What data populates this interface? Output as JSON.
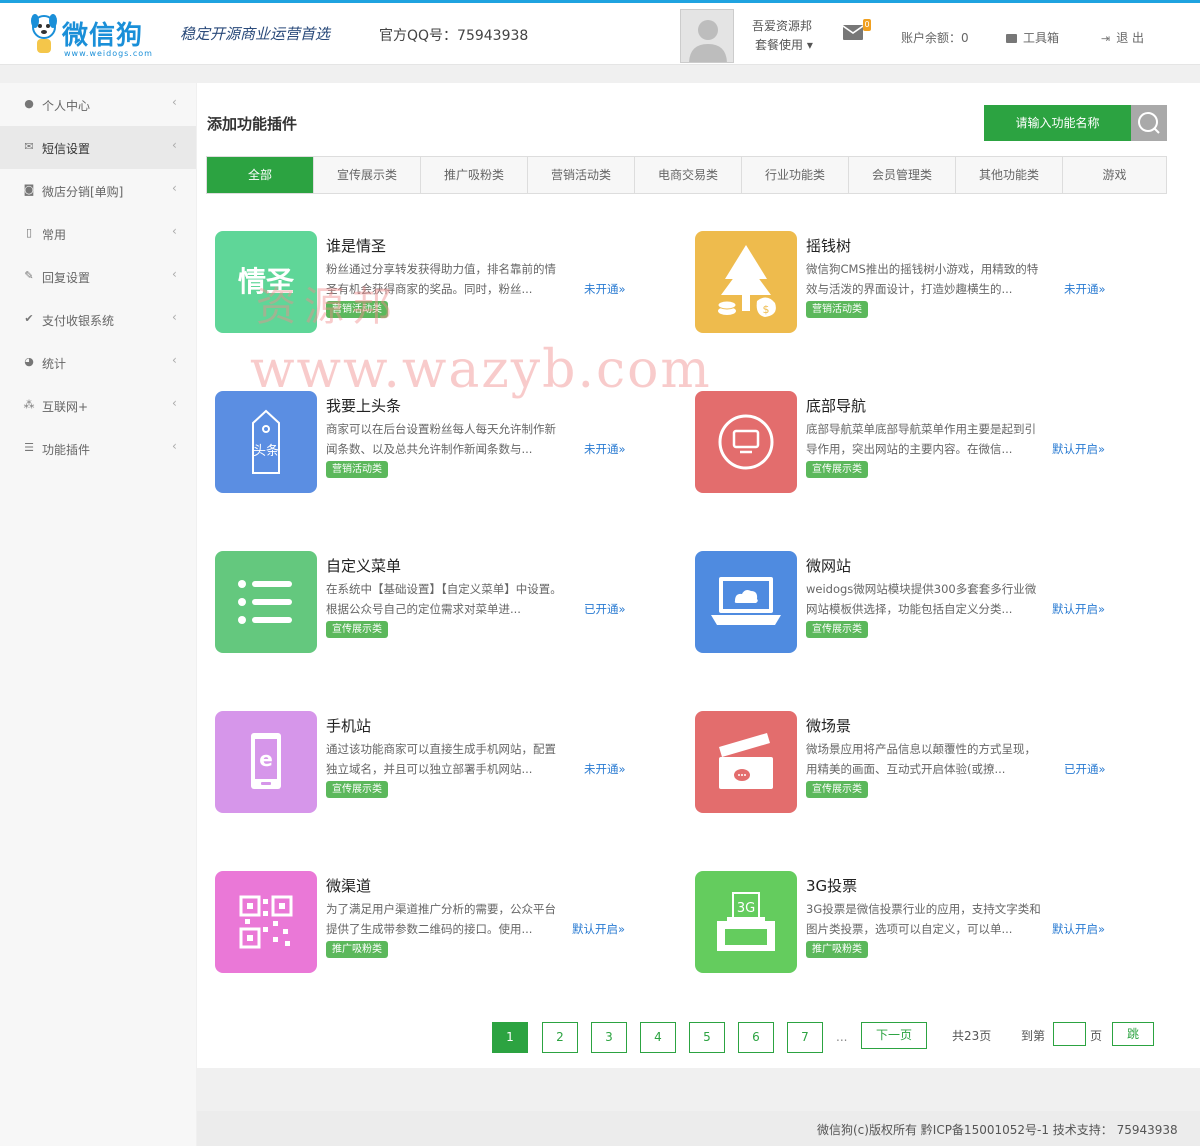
{
  "header": {
    "logo_text": "微信狗",
    "logo_sub": "www.weidogs.com",
    "slogan": "稳定开源商业运营首选",
    "qq": "官方QQ号：75943938",
    "username": "吾爱资源邦",
    "plan": "套餐使用 ▾",
    "mail_badge": "0",
    "balance": "账户余额：0",
    "toolbox": "工具箱",
    "logout": "退 出"
  },
  "sidebar": {
    "items": [
      {
        "label": "个人中心",
        "icon": "user-icon"
      },
      {
        "label": "短信设置",
        "icon": "envelope-icon"
      },
      {
        "label": "微店分销[单购]",
        "icon": "camera-icon"
      },
      {
        "label": "常用",
        "icon": "bookmark-icon"
      },
      {
        "label": "回复设置",
        "icon": "edit-icon"
      },
      {
        "label": "支付收银系统",
        "icon": "check-circle-icon"
      },
      {
        "label": "统计",
        "icon": "pie-chart-icon"
      },
      {
        "label": "互联网+",
        "icon": "share-icon"
      },
      {
        "label": "功能插件",
        "icon": "list-icon"
      }
    ]
  },
  "main": {
    "title": "添加功能插件",
    "search_placeholder": "请输入功能名称",
    "tabs": [
      "全部",
      "宣传展示类",
      "推广吸粉类",
      "营销活动类",
      "电商交易类",
      "行业功能类",
      "会员管理类",
      "其他功能类",
      "游戏"
    ],
    "cards": [
      {
        "title": "谁是情圣",
        "desc": "粉丝通过分享转发获得助力值，排名靠前的情圣有机会获得商家的奖品。同时，粉丝...",
        "tag": "营销活动类",
        "status": "未开通»",
        "color": "#5fd698",
        "glyph": "情圣"
      },
      {
        "title": "摇钱树",
        "desc": "微信狗CMS推出的摇钱树小游戏，用精致的特效与活泼的界面设计，打造妙趣横生的...",
        "tag": "营销活动类",
        "status": "未开通»",
        "color": "#eebb4d",
        "glyph": "tree"
      },
      {
        "title": "我要上头条",
        "desc": "商家可以在后台设置粉丝每人每天允许制作新闻条数、以及总共允许制作新闻条数与...",
        "tag": "营销活动类",
        "status": "未开通»",
        "color": "#5b8ee2",
        "glyph": "头条"
      },
      {
        "title": "底部导航",
        "desc": "底部导航菜单底部导航菜单作用主要是起到引导作用，突出网站的主要内容。在微信...",
        "tag": "宣传展示类",
        "status": "默认开启»",
        "color": "#e36d6d",
        "glyph": "nav"
      },
      {
        "title": "自定义菜单",
        "desc": "在系统中【基础设置】【自定义菜单】中设置。 根据公众号自己的定位需求对菜单进...",
        "tag": "宣传展示类",
        "status": "已开通»",
        "color": "#64c87e",
        "glyph": "menu"
      },
      {
        "title": "微网站",
        "desc": "weidogs微网站模块提供300多套套多行业微网站模板供选择，功能包括自定义分类...",
        "tag": "宣传展示类",
        "status": "默认开启»",
        "color": "#4f8be0",
        "glyph": "laptop"
      },
      {
        "title": "手机站",
        "desc": "通过该功能商家可以直接生成手机网站，配置独立域名，并且可以独立部署手机网站...",
        "tag": "宣传展示类",
        "status": "未开通»",
        "color": "#d696ea",
        "glyph": "phone"
      },
      {
        "title": "微场景",
        "desc": "微场景应用将产品信息以颠覆性的方式呈现，用精美的画面、互动式开启体验(或撩...",
        "tag": "宣传展示类",
        "status": "已开通»",
        "color": "#e36d6d",
        "glyph": "clap"
      },
      {
        "title": "微渠道",
        "desc": "为了满足用户渠道推广分析的需要，公众平台提供了生成带参数二维码的接口。使用...",
        "tag": "推广吸粉类",
        "status": "默认开启»",
        "color": "#ea78d7",
        "glyph": "qr"
      },
      {
        "title": "3G投票",
        "desc": "3G投票是微信投票行业的应用，支持文字类和图片类投票，选项可以自定义，可以单...",
        "tag": "推广吸粉类",
        "status": "默认开启»",
        "color": "#64cc5e",
        "glyph": "vote"
      }
    ]
  },
  "pagination": {
    "pages": [
      "1",
      "2",
      "3",
      "4",
      "5",
      "6",
      "7"
    ],
    "dots": "...",
    "next": "下一页",
    "total": "共23页",
    "goto": "到第",
    "unit": "页",
    "jump": "跳"
  },
  "footer": {
    "text": "微信狗(c)版权所有 黔ICP备15001052号-1 技术支持：  75943938"
  },
  "watermark": {
    "line1": "资源邦",
    "line2": "www.wazyb.com"
  }
}
